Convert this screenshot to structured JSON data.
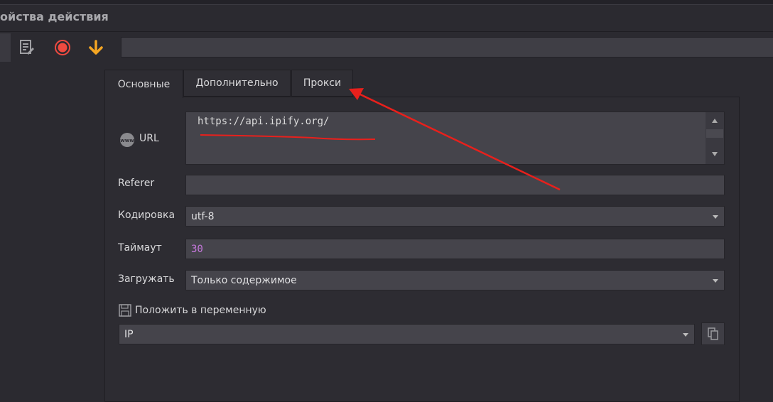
{
  "window": {
    "title": "ойства действия"
  },
  "toolbar": {
    "input_value": ""
  },
  "tabs": [
    {
      "label": "Основные"
    },
    {
      "label": "Дополнительно"
    },
    {
      "label": "Прокси"
    }
  ],
  "form": {
    "url": {
      "label": "URL",
      "value": "https://api.ipify.org/"
    },
    "referer": {
      "label": "Referer",
      "value": ""
    },
    "encoding": {
      "label": "Кодировка",
      "value": "utf-8"
    },
    "timeout": {
      "label": "Таймаут",
      "value": "30"
    },
    "load": {
      "label": "Загружать",
      "value": "Только содержимое"
    },
    "save_var": {
      "label": "Положить в переменную",
      "value": "IP"
    }
  },
  "colors": {
    "annotation": "#e8201c",
    "timeout_value": "#c678dd",
    "record": "#f04a40",
    "download": "#f5a623"
  }
}
